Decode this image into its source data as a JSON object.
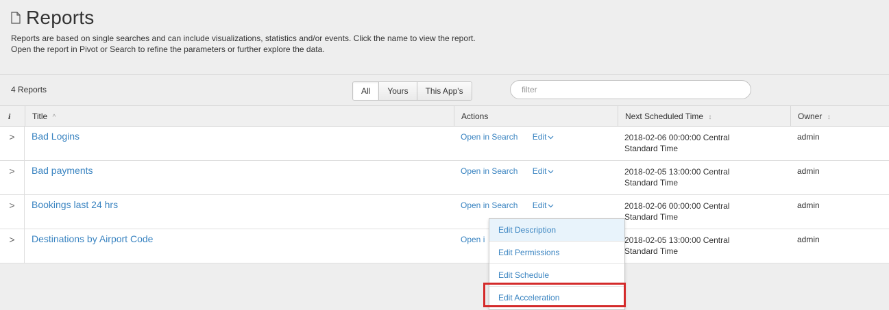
{
  "header": {
    "title": "Reports",
    "desc_line1": "Reports are based on single searches and can include visualizations, statistics and/or events. Click the name to view the report.",
    "desc_line2": "Open the report in Pivot or Search to refine the parameters or further explore the data."
  },
  "toolbar": {
    "count": "4 Reports",
    "filters": [
      "All",
      "Yours",
      "This App's"
    ],
    "active_filter": "All",
    "filter_placeholder": "filter"
  },
  "table": {
    "columns": {
      "info": "i",
      "title": "Title",
      "title_sort": "^",
      "actions": "Actions",
      "next_scheduled": "Next Scheduled Time",
      "owner": "Owner",
      "sort_icon": "↕"
    },
    "rows": [
      {
        "expander": ">",
        "title": "Bad Logins",
        "action_open": "Open in Search",
        "action_edit": "Edit",
        "time_line1": "2018-02-06 00:00:00 Central",
        "time_line2": "Standard Time",
        "owner": "admin"
      },
      {
        "expander": ">",
        "title": "Bad payments",
        "action_open": "Open in Search",
        "action_edit": "Edit",
        "time_line1": "2018-02-05 13:00:00 Central",
        "time_line2": "Standard Time",
        "owner": "admin"
      },
      {
        "expander": ">",
        "title": "Bookings last 24 hrs",
        "action_open": "Open in Search",
        "action_edit": "Edit",
        "time_line1": "2018-02-06 00:00:00 Central",
        "time_line2": "Standard Time",
        "owner": "admin"
      },
      {
        "expander": ">",
        "title": "Destinations by Airport Code",
        "action_open": "Open i",
        "action_edit": "",
        "time_line1": "2018-02-05 13:00:00 Central",
        "time_line2": "Standard Time",
        "owner": "admin"
      }
    ]
  },
  "edit_menu": {
    "items": [
      "Edit Description",
      "Edit Permissions",
      "Edit Schedule",
      "Edit Acceleration"
    ],
    "hovered": "Edit Description",
    "highlighted": "Edit Acceleration"
  },
  "colors": {
    "link": "#3a84c1",
    "highlight": "#d42a2a",
    "background": "#eeeeee"
  }
}
